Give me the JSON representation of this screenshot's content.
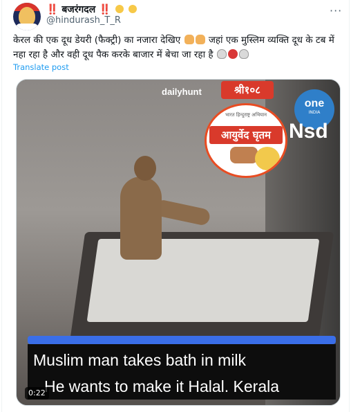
{
  "tweet": {
    "display_name": "बजरंगदल",
    "prefix": "‼️",
    "suffix": "‼️",
    "handle": "@hindurash_T_R",
    "text_line1": "केरल की एक दूध डेयरी (फैक्ट्री) का नजारा देखिए",
    "text_line1b": "जहां एक मुस्लिम व्यक्ति दूध के",
    "text_line2": "टब में नहा रहा है और वही दूध पैक करके बाजार में बेचा जा रहा है",
    "translate": "Translate post",
    "more": "···"
  },
  "video": {
    "watermark_dailyhunt": "dailyhunt",
    "shri_tag": "श्री१०८",
    "badge_top": "भारत हिन्दुराष्ट्र अभियान",
    "badge_banner": "आयुर्वेद घृतम",
    "oneindia_one": "one",
    "oneindia_india": "INDIA",
    "nsd": "Nsd",
    "caption_line1": "Muslim man takes bath in milk",
    "caption_line2": "He wants to make it Halal. Kerala",
    "timestamp": "0:22"
  },
  "icons": [
    "avatar",
    "clapping-hands-icon",
    "pointing-hand-icon",
    "skull-crossbones-icon",
    "angry-face-icon",
    "more-icon"
  ]
}
